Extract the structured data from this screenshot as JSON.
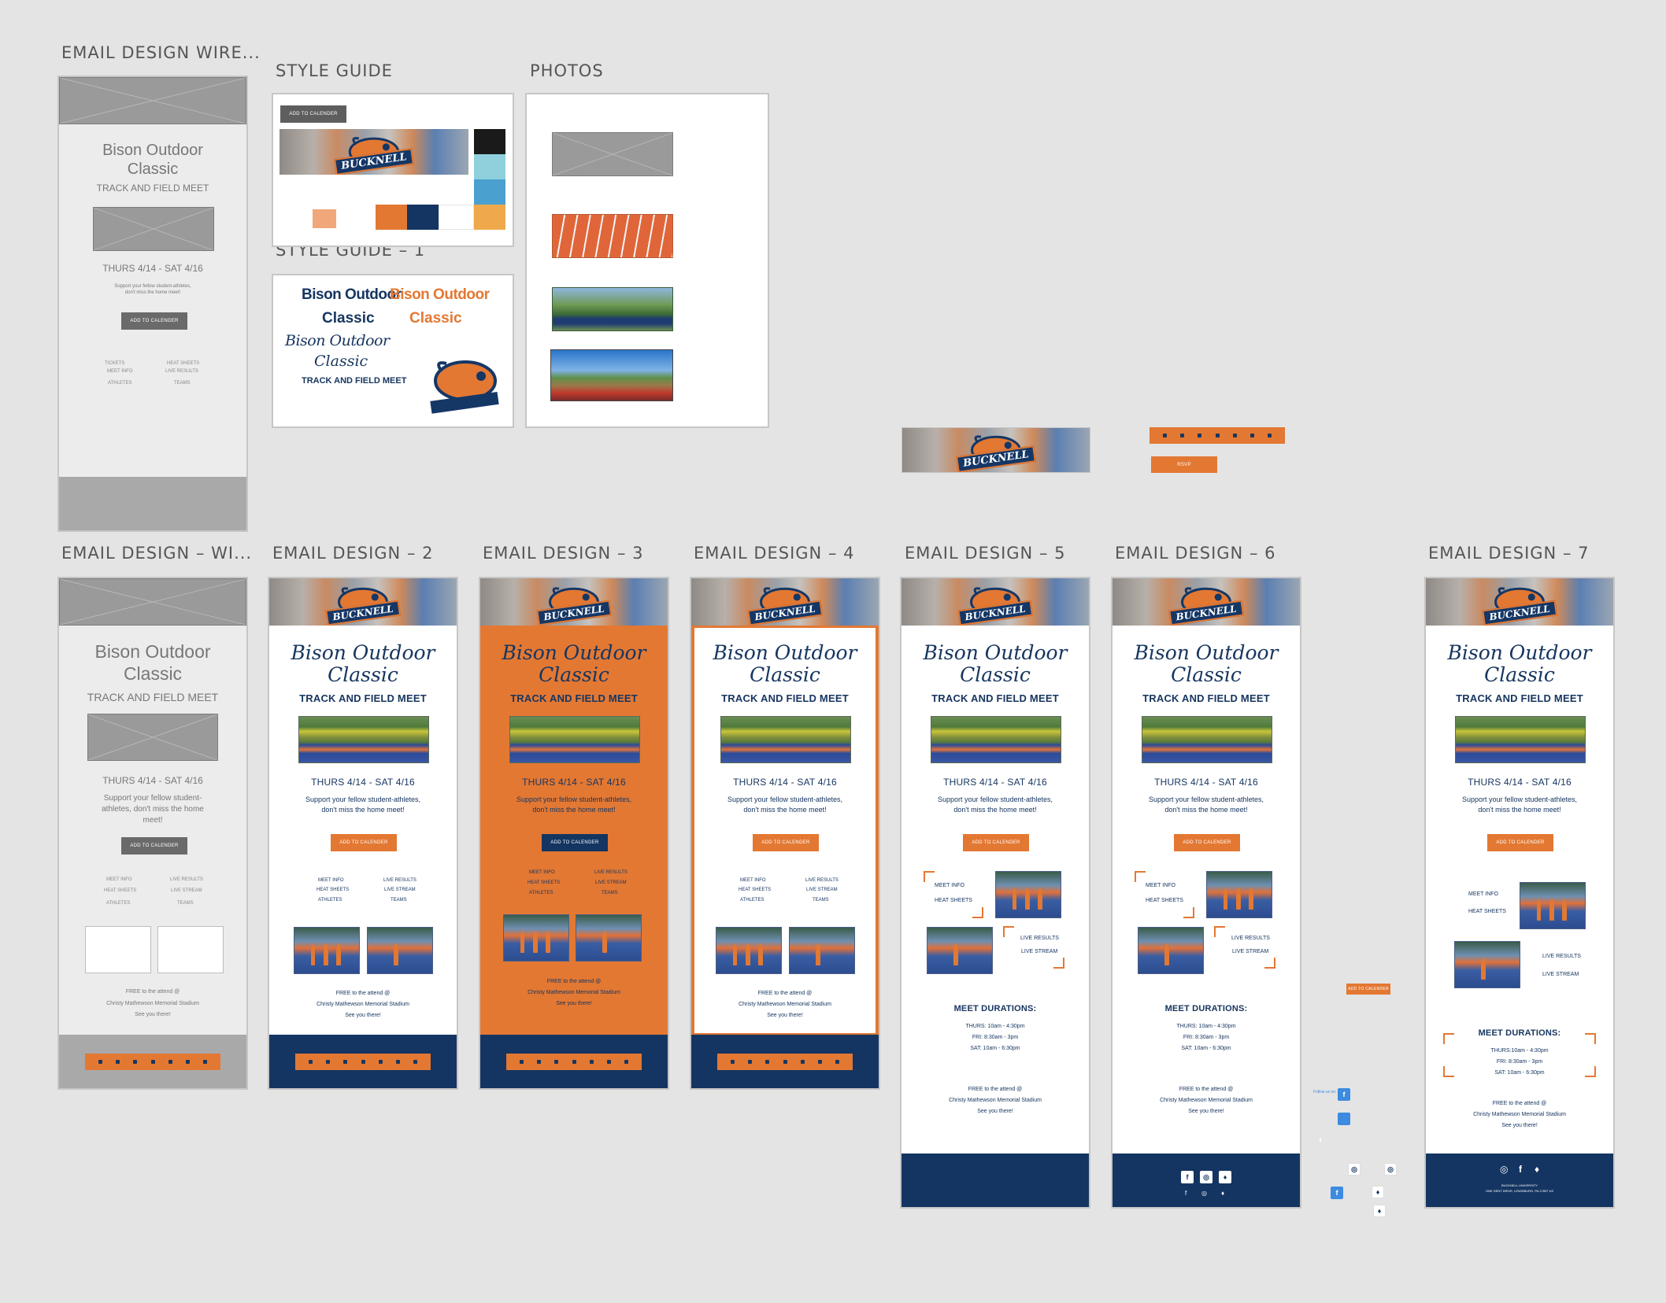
{
  "canvas_labels": {
    "wire1": "EMAIL DESIGN WIRE...",
    "style_guide": "STYLE GUIDE",
    "photos": "PHOTOS",
    "style_guide_1": "STYLE GUIDE – 1",
    "wire2": "EMAIL DESIGN – WI...",
    "d2": "EMAIL DESIGN – 2",
    "d3": "EMAIL DESIGN – 3",
    "d4": "EMAIL DESIGN – 4",
    "d5": "EMAIL DESIGN – 5",
    "d6": "EMAIL DESIGN – 6",
    "d7": "EMAIL DESIGN – 7"
  },
  "email": {
    "title_line1": "Bison Outdoor",
    "title_line2": "Classic",
    "subtitle": "TRACK AND FIELD MEET",
    "dates": "THURS 4/14 - SAT 4/16",
    "wire_dates": "THURS 4/14 - SAT 4/16",
    "blurb_line1": "Support your fellow student-athletes,",
    "blurb_line2": "don't miss the home meet!",
    "wire_blurb_line1": "Support your fellow student-",
    "wire_blurb_line2": "athletes, don't miss the home",
    "wire_blurb_line3": "meet!",
    "wire1_blurb_line1": "Support your fellow student-athletes,",
    "wire1_blurb_line2": "don't miss the home meet!",
    "cta": "ADD TO CALENDER",
    "links_left": [
      "MEET INFO",
      "HEAT SHEETS",
      "ATHLETES"
    ],
    "links_right": [
      "LIVE RESULTS",
      "LIVE STREAM",
      "TEAMS"
    ],
    "wire1_links_left": [
      "TICKETS",
      "MEET INFO",
      "ATHLETES"
    ],
    "wire1_links_right": [
      "HEAT SHEETS",
      "LIVE RESULTS",
      "TEAMS"
    ],
    "free_line1": "FREE to the attend @",
    "free_line2": "Christy Mathewson Memorial Stadium",
    "free_line3": "See you there!",
    "durations_title": "MEET DURATIONS:",
    "dur_thurs": "THURS: 10am - 4:30pm",
    "dur_fri": "FRI: 8:30am - 3pm",
    "dur_sat": "SAT: 10am - 6:30pm",
    "d7_dur_thurs": "THURS:10am - 4:30pm",
    "wordmark": "BUCKNELL",
    "footer_line1": "BUCKNELL UNIVERSITY",
    "footer_line2": "ONE DENT DRIVE, LEWISBURG, PA 17837 US"
  },
  "style_guide": {
    "button": "ADD TO CALENDER",
    "font_sample_1a": "Bison Outdoor",
    "font_sample_1b": "Classic",
    "font_sample_2a": "Bison Outdoor",
    "font_sample_2b": "Classic",
    "font_sample_3a": "Bison Outdoor",
    "font_sample_3b": "Classic",
    "font_sample_4": "TRACK AND FIELD MEET",
    "colors": [
      "#1a1a1a",
      "#8fd0dc",
      "#4aa0cf",
      "#efa94a",
      "#e37833",
      "#143561",
      "#ffffff",
      "#f0a87a"
    ]
  },
  "loose": {
    "rsvp": "RSVP",
    "add_cal": "ADD TO CALENDER",
    "follow_tiny": "Follow us on:"
  },
  "colors": {
    "orange": "#e37833",
    "navy": "#143561",
    "wire_gray": "#6a6a6a"
  }
}
